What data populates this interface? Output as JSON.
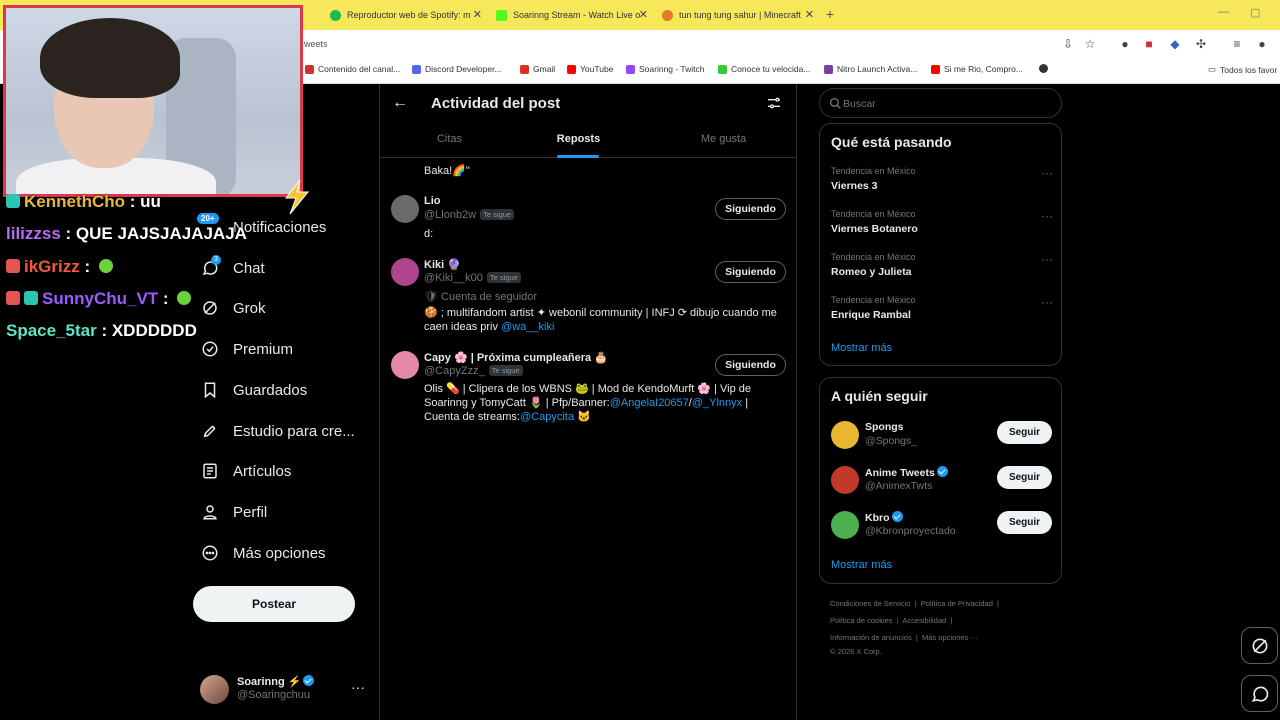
{
  "browser": {
    "tabs": [
      {
        "title": "Reproductor web de Spotify: m",
        "color": "#1db954"
      },
      {
        "title": "Soarinng Stream - Watch Live o",
        "color": "#53fc18"
      },
      {
        "title": "tun tung tung sahur | Minecraft",
        "color": "#e57a2a"
      }
    ],
    "new_tab": "+",
    "url": "weets",
    "bookmarks": [
      {
        "label": "Contenido del canal...",
        "color": "#cc3333"
      },
      {
        "label": "Discord Developer...",
        "color": "#5865f2"
      },
      {
        "label": "Gmail",
        "color": "#d93025"
      },
      {
        "label": "YouTube",
        "color": "#ff0000"
      },
      {
        "label": "Soarinng - Twitch",
        "color": "#9146ff"
      },
      {
        "label": "Conoce tu velocida...",
        "color": "#37c837"
      },
      {
        "label": "Nitro Launch Activa...",
        "color": "#7a3fa0"
      },
      {
        "label": "Si me Rio, Compro...",
        "color": "#ff0000"
      }
    ],
    "all_bookmarks": "Todos los favor"
  },
  "chat": [
    {
      "user": "KennethCho",
      "sep": " : ",
      "msg": "uu",
      "color": "#e5b93c",
      "badge": "#2ec5b0"
    },
    {
      "user": "lilizzss",
      "sep": " : ",
      "msg": "QUE JAJSJAJAJAJA",
      "color": "#b66cf0",
      "badge": ""
    },
    {
      "user": "ikGrizz",
      "sep": " : ",
      "msg": "",
      "color": "#f25a3c",
      "badge": "#e25555"
    },
    {
      "user": "SunnyChu_VT",
      "sep": " : ",
      "msg": "",
      "color": "#9a5cff",
      "badge": "#2ec5b0"
    },
    {
      "user": "Space_5tar",
      "sep": " : ",
      "msg": "XDDDDDD",
      "color": "#5fe3c5",
      "badge": ""
    }
  ],
  "nav": {
    "notifications": "Notificaciones",
    "notif_count": "20+",
    "chat": "Chat",
    "chat_count": "3",
    "grok": "Grok",
    "premium": "Premium",
    "bookmarks": "Guardados",
    "studio": "Estudio para cre...",
    "articles": "Artículos",
    "profile": "Perfil",
    "more": "Más opciones",
    "post": "Postear"
  },
  "me": {
    "name": "Soarinng ⚡",
    "handle": "@Soaringchuu"
  },
  "activity": {
    "title": "Actividad del post",
    "tabs": [
      "Citas",
      "Reposts",
      "Me gusta"
    ],
    "active_tab": "Reposts",
    "partial_text": "Baka!🌈\"",
    "users": [
      {
        "name": "Lio",
        "handle": "@Llonb2w",
        "follows_you": "Te sigue",
        "button": "Siguiendo",
        "bio": "d:",
        "sub": "",
        "avatar": "#6a6a6a"
      },
      {
        "name": "Kiki 🔮",
        "handle": "@Kiki__k00",
        "follows_you": "Te sigue",
        "button": "Siguiendo",
        "sub": "🛡 Cuenta de seguidor",
        "bio": "🍪 ; multifandom artist ✦ webonil community | INFJ ⟳ dibujo cuando me caen ideas priv",
        "bio_link": "@wa__kiki",
        "avatar": "#b0448e"
      },
      {
        "name": "Capy 🌸 | Próxima cumpleañera 🎂",
        "handle": "@CapyZzz_",
        "follows_you": "Te sigue",
        "button": "Siguiendo",
        "bio_a": "Olis 💊 | Clipera de los WBNS 🐸 | Mod de KendoMurft 🌸 | Vip de Soarinng y TomyCatt 🌷 | Pfp/Banner:",
        "bio_link_a": "@AngelaI20657",
        "bio_sep": "/",
        "bio_link_b": "@_Ylnnyx",
        "bio_b": " | Cuenta de streams:",
        "bio_link_c": "@Capycita",
        "bio_end": " 🐱",
        "avatar": "#e48aa6"
      }
    ]
  },
  "right": {
    "search_placeholder": "Buscar",
    "trending_title": "Qué está pasando",
    "trends": [
      {
        "context": "Tendencia en México",
        "name": "Viernes 3"
      },
      {
        "context": "Tendencia en México",
        "name": "Viernes Botanero"
      },
      {
        "context": "Tendencia en México",
        "name": "Romeo y Julieta"
      },
      {
        "context": "Tendencia en México",
        "name": "Enrique Rambal"
      }
    ],
    "show_more": "Mostrar más",
    "who_title": "A quién seguir",
    "who": [
      {
        "name": "Spongs",
        "handle": "@Spongs_",
        "verified": false,
        "button": "Seguir",
        "avatar": "#e8b72f"
      },
      {
        "name": "Anime Tweets",
        "handle": "@AnimexTwts",
        "verified": true,
        "button": "Seguir",
        "avatar": "#c0392b"
      },
      {
        "name": "Kbro",
        "handle": "@Kbronproyectado",
        "verified": true,
        "button": "Seguir",
        "avatar": "#4caf50"
      }
    ],
    "who_more": "Mostrar más",
    "footer": {
      "l1a": "Condiciones de Servicio",
      "l1b": "Política de Privacidad",
      "l2a": "Política de cookies",
      "l2b": "Accesibilidad",
      "l3a": "Información de anuncios",
      "l3b": "Más opciones ···",
      "copy": "© 2026 X Corp."
    }
  }
}
